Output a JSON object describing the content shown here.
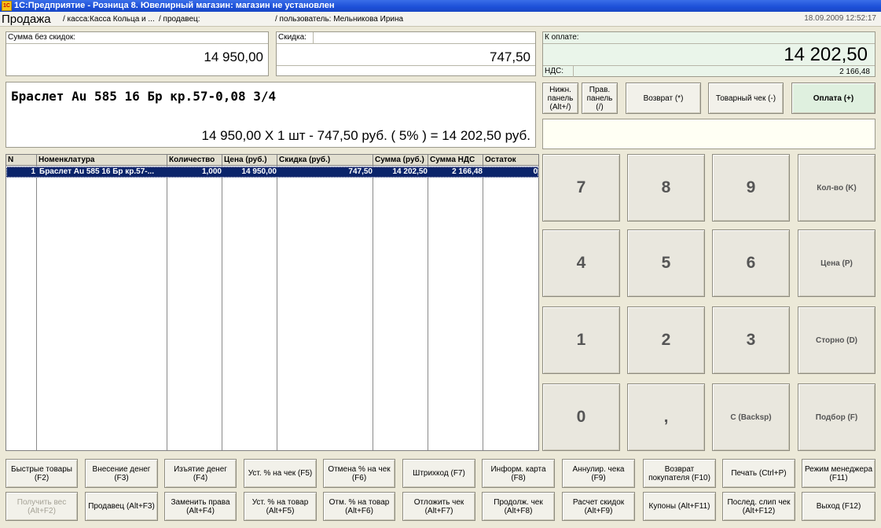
{
  "window": {
    "title": "1С:Предприятие - Розница 8. Ювелирный магазин: магазин не установлен",
    "icon_text": "1С"
  },
  "header": {
    "doc_title": "Продажа",
    "kassa": "/ касса:Касса  Кольца и ...",
    "seller": "/ продавец:",
    "user": "/ пользователь: Мельникова Ирина",
    "datetime": "18.09.2009 12:52:17"
  },
  "totals": {
    "sum_label": "Сумма без скидок:",
    "sum_value": "14 950,00",
    "discount_label": "Скидка:",
    "discount_value": "747,50",
    "pay_label": "К оплате:",
    "pay_value": "14 202,50",
    "vat_label": "НДС:",
    "vat_value": "2 166,48"
  },
  "item_info": {
    "name": "Браслет Au 585 16 Бр кр.57-0,08 3/4",
    "calc": "14 950,00  Х 1 шт - 747,50  руб. ( 5% )  = 14 202,50  руб."
  },
  "grid": {
    "columns": [
      "N",
      "Номенклатура",
      "Количество",
      "Цена (руб.)",
      "Скидка (руб.)",
      "Сумма (руб.)",
      "Сумма НДС",
      "Остаток"
    ],
    "rows": [
      [
        "1",
        "Браслет Au 585 16 Бр кр.57-...",
        "1,000",
        "14 950,00",
        "747,50",
        "14 202,50",
        "2 166,48",
        "0"
      ]
    ]
  },
  "top_buttons": {
    "lower_panel": "Нижн. панель (Alt+/)",
    "right_panel": "Прав. панель (/)",
    "return": "Возврат (*)",
    "receipt": "Товарный чек (-)",
    "payment": "Оплата (+)"
  },
  "keypad": {
    "k7": "7",
    "k8": "8",
    "k9": "9",
    "qty": "Кол-во (K)",
    "k4": "4",
    "k5": "5",
    "k6": "6",
    "price": "Цена (P)",
    "k1": "1",
    "k2": "2",
    "k3": "3",
    "storno": "Сторно (D)",
    "k0": "0",
    "comma": ",",
    "backsp": "C (Backsp)",
    "select": "Подбор (F)"
  },
  "bottom_row1": [
    "Быстрые товары (F2)",
    "Внесение денег (F3)",
    "Изъятие денег (F4)",
    "Уст. % на чек (F5)",
    "Отмена % на чек (F6)",
    "Штрихкод (F7)",
    "Информ. карта (F8)",
    "Аннулир. чека (F9)",
    "Возврат покупателя (F10)",
    "Печать (Ctrl+P)",
    "Режим менеджера (F11)"
  ],
  "bottom_row2": [
    "Получить вес (Alt+F2)",
    "Продавец (Alt+F3)",
    "Заменить права (Alt+F4)",
    "Уст. % на товар (Alt+F5)",
    "Отм. % на товар (Alt+F6)",
    "Отложить чек (Alt+F7)",
    "Продолж. чек (Alt+F8)",
    "Расчет скидок (Alt+F9)",
    "Купоны (Alt+F11)",
    "Послед. слип чек (Alt+F12)",
    "Выход (F12)"
  ],
  "colors": {
    "titlebar": "#1c4fd8",
    "selected_row": "#0a246a",
    "pay_panel": "#eaf5ea"
  }
}
